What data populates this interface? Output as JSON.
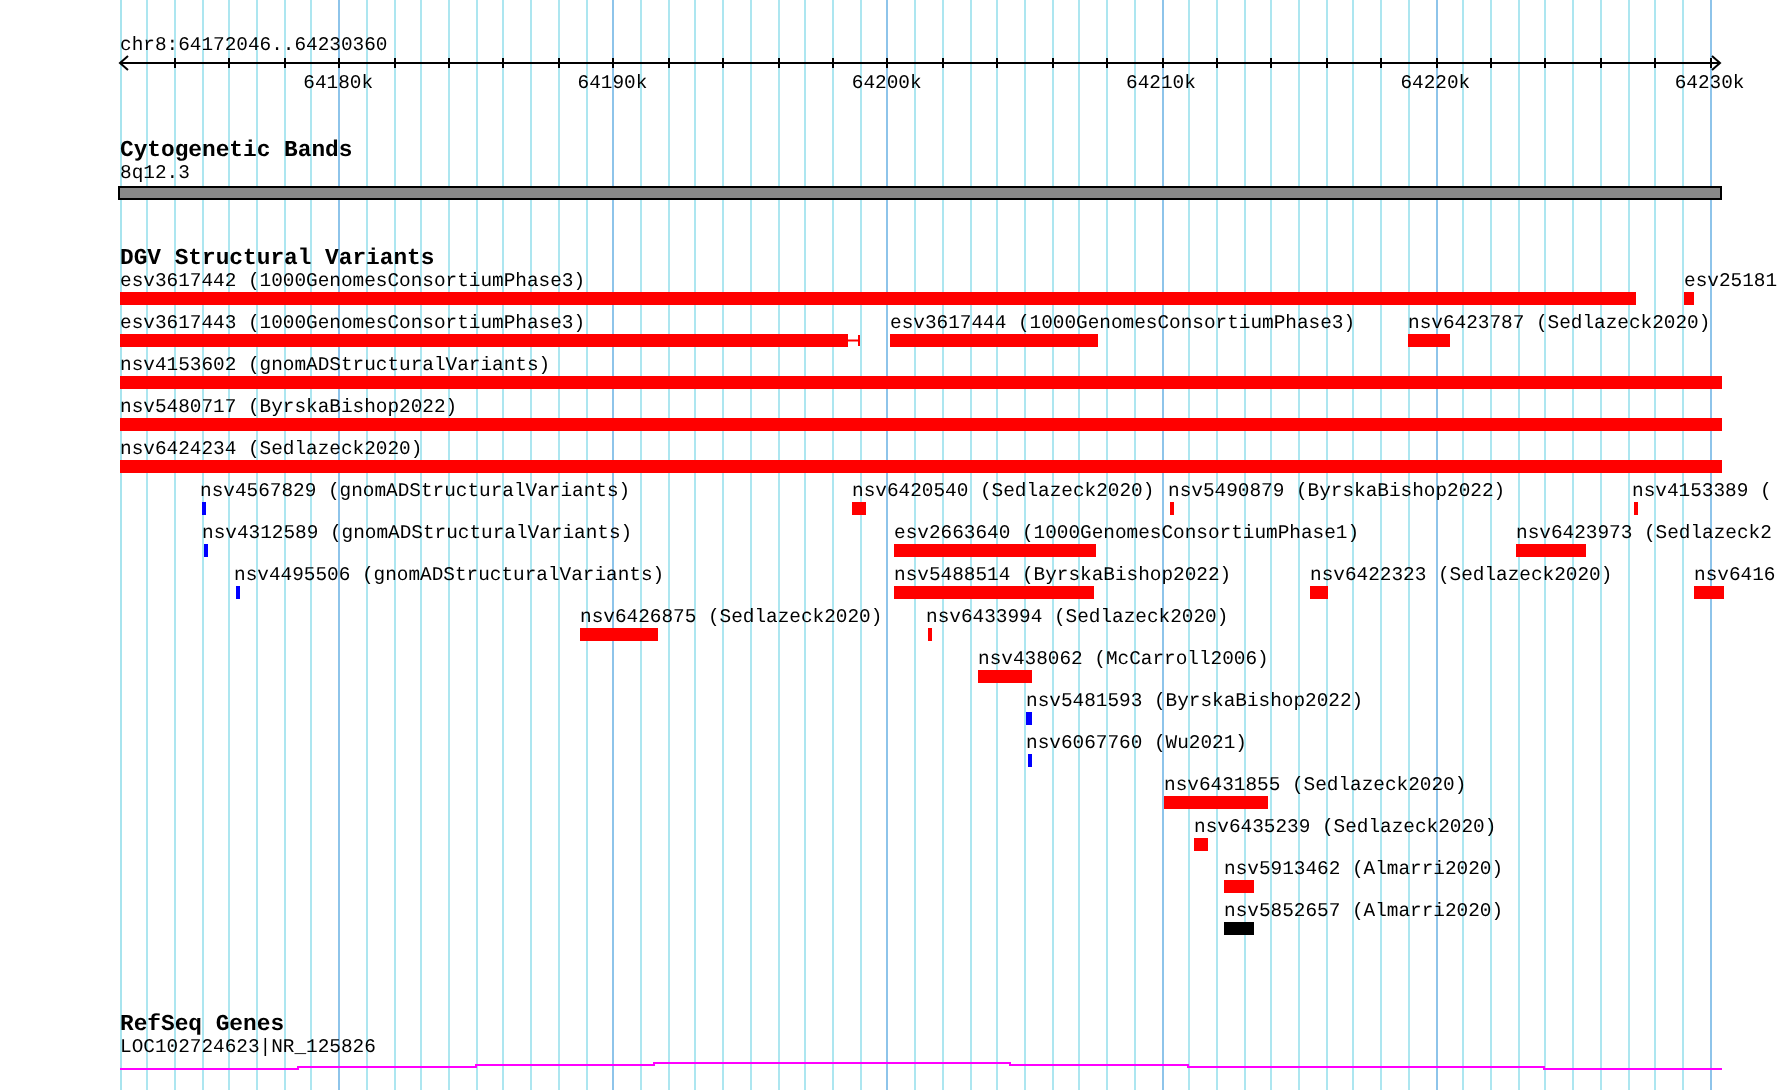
{
  "ruler": {
    "position": "chr8:64172046..64230360",
    "ticks": [
      "64180k",
      "64190k",
      "64200k",
      "64210k",
      "64220k",
      "64230k"
    ]
  },
  "tracks": [
    {
      "title": "Cytogenetic Bands",
      "kind": "bands",
      "items": [
        {
          "label": "8q12.3"
        }
      ]
    },
    {
      "title": "DGV Structural Variants",
      "kind": "variants",
      "items": [
        {
          "label": "esv3617442 (1000GenomesConsortiumPhase3)",
          "color": "#ff0000"
        },
        {
          "label": "esv25181",
          "color": "#ff0000"
        },
        {
          "label": "esv3617443 (1000GenomesConsortiumPhase3)",
          "color": "#ff0000"
        },
        {
          "label": "esv3617444 (1000GenomesConsortiumPhase3)",
          "color": "#ff0000"
        },
        {
          "label": "nsv6423787 (Sedlazeck2020)",
          "color": "#ff0000"
        },
        {
          "label": "nsv4153602 (gnomADStructuralVariants)",
          "color": "#ff0000"
        },
        {
          "label": "nsv5480717 (ByrskaBishop2022)",
          "color": "#ff0000"
        },
        {
          "label": "nsv6424234 (Sedlazeck2020)",
          "color": "#ff0000"
        },
        {
          "label": "nsv4567829 (gnomADStructuralVariants)",
          "color": "#0000ff"
        },
        {
          "label": "nsv6420540 (Sedlazeck2020)",
          "color": "#ff0000"
        },
        {
          "label": "nsv5490879 (ByrskaBishop2022)",
          "color": "#ff0000"
        },
        {
          "label": "nsv4153389 (",
          "color": "#ff0000"
        },
        {
          "label": "nsv4312589 (gnomADStructuralVariants)",
          "color": "#0000ff"
        },
        {
          "label": "esv2663640 (1000GenomesConsortiumPhase1)",
          "color": "#ff0000"
        },
        {
          "label": "nsv6423973 (Sedlazeck2",
          "color": "#ff0000"
        },
        {
          "label": "nsv4495506 (gnomADStructuralVariants)",
          "color": "#0000ff"
        },
        {
          "label": "nsv5488514 (ByrskaBishop2022)",
          "color": "#ff0000"
        },
        {
          "label": "nsv6422323 (Sedlazeck2020)",
          "color": "#ff0000"
        },
        {
          "label": "nsv6416",
          "color": "#ff0000"
        },
        {
          "label": "nsv6426875 (Sedlazeck2020)",
          "color": "#ff0000"
        },
        {
          "label": "nsv6433994 (Sedlazeck2020)",
          "color": "#ff0000"
        },
        {
          "label": "nsv438062 (McCarroll2006)",
          "color": "#ff0000"
        },
        {
          "label": "nsv5481593 (ByrskaBishop2022)",
          "color": "#0000ff"
        },
        {
          "label": "nsv6067760 (Wu2021)",
          "color": "#0000ff"
        },
        {
          "label": "nsv6431855 (Sedlazeck2020)",
          "color": "#ff0000"
        },
        {
          "label": "nsv6435239 (Sedlazeck2020)",
          "color": "#ff0000"
        },
        {
          "label": "nsv5913462 (Almarri2020)",
          "color": "#ff0000"
        },
        {
          "label": "nsv5852657 (Almarri2020)",
          "color": "#000000"
        }
      ]
    },
    {
      "title": "RefSeq Genes",
      "kind": "genes",
      "items": [
        {
          "label": "LOC102724623|NR_125826"
        }
      ]
    }
  ]
}
